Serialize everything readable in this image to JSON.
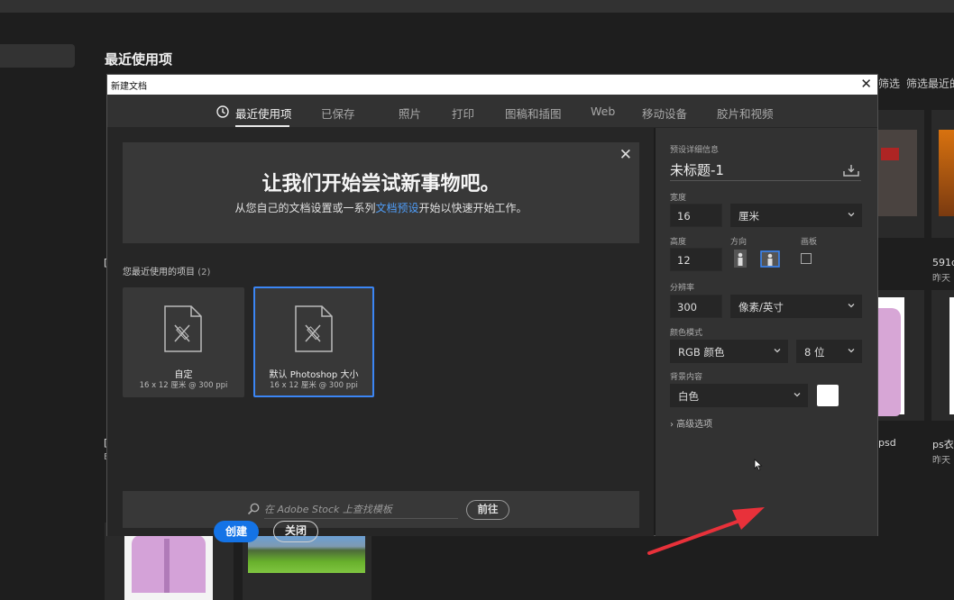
{
  "background": {
    "title": "最近使用项",
    "filters": [
      "筛选",
      "筛选最近的"
    ],
    "cards": [
      {
        "name": "591d",
        "date": "昨天"
      },
      {
        "name": "psd",
        "date": ""
      },
      {
        "name": "ps衣",
        "date": "昨天"
      }
    ],
    "left_markers": [
      "[",
      "[",
      "E"
    ]
  },
  "dialog": {
    "title": "新建文档",
    "close_glyph": "✕",
    "tabs": [
      "最近使用项",
      "已保存",
      "照片",
      "打印",
      "图稿和插图",
      "Web",
      "移动设备",
      "胶片和视频"
    ],
    "active_tab": "最近使用项"
  },
  "banner": {
    "heading": "让我们开始尝试新事物吧。",
    "text_before": "从您自己的文档设置或一系列",
    "link": "文档预设",
    "text_after": "开始以快速开始工作。",
    "close_glyph": "✕"
  },
  "recent": {
    "header": "您最近使用的项目",
    "count": "(2)",
    "items": [
      {
        "name": "自定",
        "meta": "16 x 12 厘米 @ 300 ppi",
        "selected": false
      },
      {
        "name": "默认 Photoshop 大小",
        "meta": "16 x 12 厘米 @ 300 ppi",
        "selected": true
      }
    ]
  },
  "search": {
    "placeholder": "在 Adobe Stock 上查找模板",
    "go_label": "前往"
  },
  "details": {
    "section_label": "预设详细信息",
    "doc_name": "未标题-1",
    "width_label": "宽度",
    "width_value": "16",
    "width_unit": "厘米",
    "height_label": "高度",
    "height_value": "12",
    "orientation_label": "方向",
    "canvas_label": "画板",
    "resolution_label": "分辨率",
    "resolution_value": "300",
    "resolution_unit": "像素/英寸",
    "color_mode_label": "颜色模式",
    "color_mode": "RGB 颜色",
    "bit_depth": "8 位",
    "background_label": "背景内容",
    "background_value": "白色",
    "background_color": "#ffffff",
    "advanced_label": "高级选项",
    "create_label": "创建",
    "close_label": "关闭"
  },
  "colors": {
    "accent": "#1473e6",
    "selected_border": "#3b86f5",
    "link": "#4f9df7",
    "annotation_arrow": "#e8313a"
  },
  "icons": [
    "recent-clock-icon",
    "document-icon",
    "search-icon",
    "save-preset-icon",
    "chevron-down-icon",
    "portrait-icon",
    "landscape-icon",
    "checkbox-icon",
    "cursor-icon"
  ]
}
